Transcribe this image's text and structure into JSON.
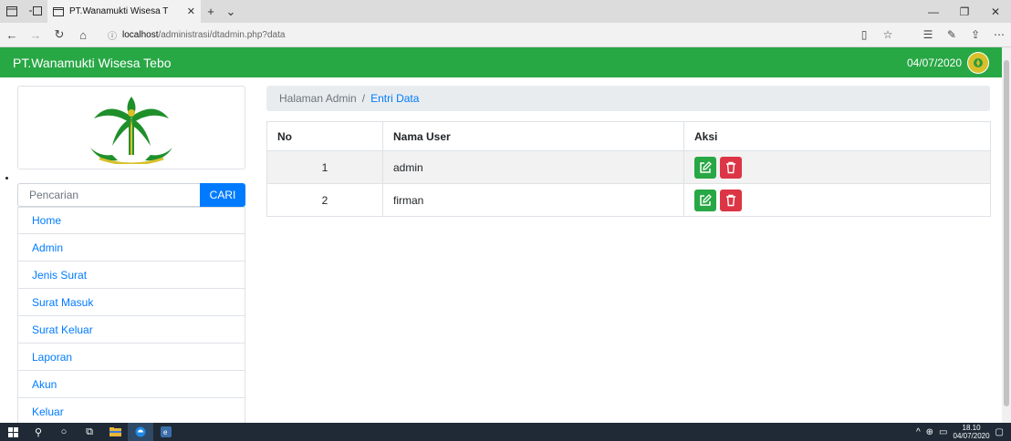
{
  "browser": {
    "tab_title": "PT.Wanamukti Wisesa T",
    "url_host": "localhost",
    "url_path": "/administrasi/dtadmin.php?data"
  },
  "app": {
    "brand": "PT.Wanamukti Wisesa Tebo",
    "date": "04/07/2020",
    "colors": {
      "navbar": "#28a745",
      "link": "#007bff",
      "edit": "#28a745",
      "delete": "#dc3545"
    }
  },
  "sidebar": {
    "search_placeholder": "Pencarian",
    "search_button": "CARI",
    "items": [
      {
        "label": "Home"
      },
      {
        "label": "Admin"
      },
      {
        "label": "Jenis Surat"
      },
      {
        "label": "Surat Masuk"
      },
      {
        "label": "Surat Keluar"
      },
      {
        "label": "Laporan"
      },
      {
        "label": "Akun"
      },
      {
        "label": "Keluar"
      }
    ]
  },
  "breadcrumb": {
    "home": "Halaman Admin",
    "separator": "/",
    "active": "Entri Data"
  },
  "table": {
    "headers": [
      "No",
      "Nama User",
      "Aksi"
    ],
    "rows": [
      {
        "no": "1",
        "user": "admin"
      },
      {
        "no": "2",
        "user": "firman"
      }
    ]
  },
  "taskbar": {
    "time": "18.10",
    "date": "04/07/2020"
  }
}
